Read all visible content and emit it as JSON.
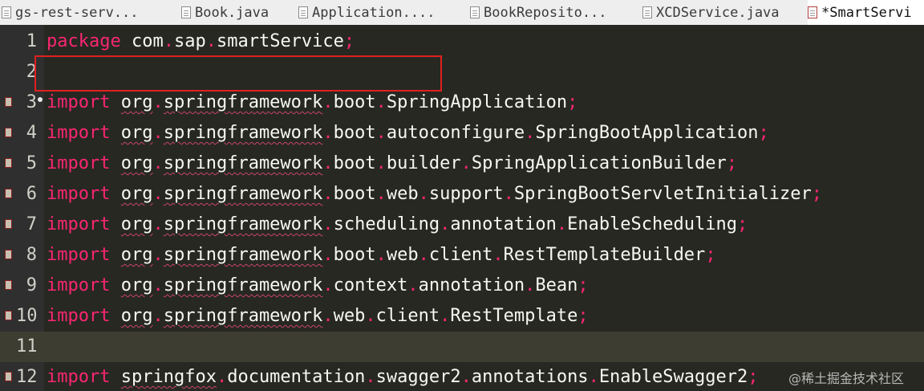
{
  "tabs": [
    {
      "label": "gs-rest-serv...",
      "active": false
    },
    {
      "label": "Book.java",
      "active": false
    },
    {
      "label": "Application....",
      "active": false
    },
    {
      "label": "BookReposito...",
      "active": false
    },
    {
      "label": "XCDService.java",
      "active": false
    },
    {
      "label": "*SmartServi",
      "active": true
    }
  ],
  "editor": {
    "lines": [
      {
        "n": "1",
        "kw": "package",
        "parts": [
          "com",
          "sap",
          "smartService"
        ]
      },
      {
        "n": "2"
      },
      {
        "n": "3",
        "kw": "import",
        "parts": [
          "org",
          "springframework",
          "boot",
          "SpringApplication"
        ]
      },
      {
        "n": "4",
        "kw": "import",
        "parts": [
          "org",
          "springframework",
          "boot",
          "autoconfigure",
          "SpringBootApplication"
        ]
      },
      {
        "n": "5",
        "kw": "import",
        "parts": [
          "org",
          "springframework",
          "boot",
          "builder",
          "SpringApplicationBuilder"
        ]
      },
      {
        "n": "6",
        "kw": "import",
        "parts": [
          "org",
          "springframework",
          "boot",
          "web",
          "support",
          "SpringBootServletInitializer"
        ]
      },
      {
        "n": "7",
        "kw": "import",
        "parts": [
          "org",
          "springframework",
          "scheduling",
          "annotation",
          "EnableScheduling"
        ]
      },
      {
        "n": "8",
        "kw": "import",
        "parts": [
          "org",
          "springframework",
          "boot",
          "web",
          "client",
          "RestTemplateBuilder"
        ]
      },
      {
        "n": "9",
        "kw": "import",
        "parts": [
          "org",
          "springframework",
          "context",
          "annotation",
          "Bean"
        ]
      },
      {
        "n": "10",
        "kw": "import",
        "parts": [
          "org",
          "springframework",
          "web",
          "client",
          "RestTemplate"
        ]
      },
      {
        "n": "11"
      },
      {
        "n": "12",
        "kw": "import",
        "parts": [
          "springfox",
          "documentation",
          "swagger2",
          "annotations",
          "EnableSwagger2"
        ]
      }
    ]
  },
  "watermark": "@稀土掘金技术社区",
  "colors": {
    "editor_bg": "#272822",
    "keyword": "#f92672",
    "text": "#f8f8f2",
    "highlight_box": "#e02020",
    "current_line": "#3e3d32"
  }
}
